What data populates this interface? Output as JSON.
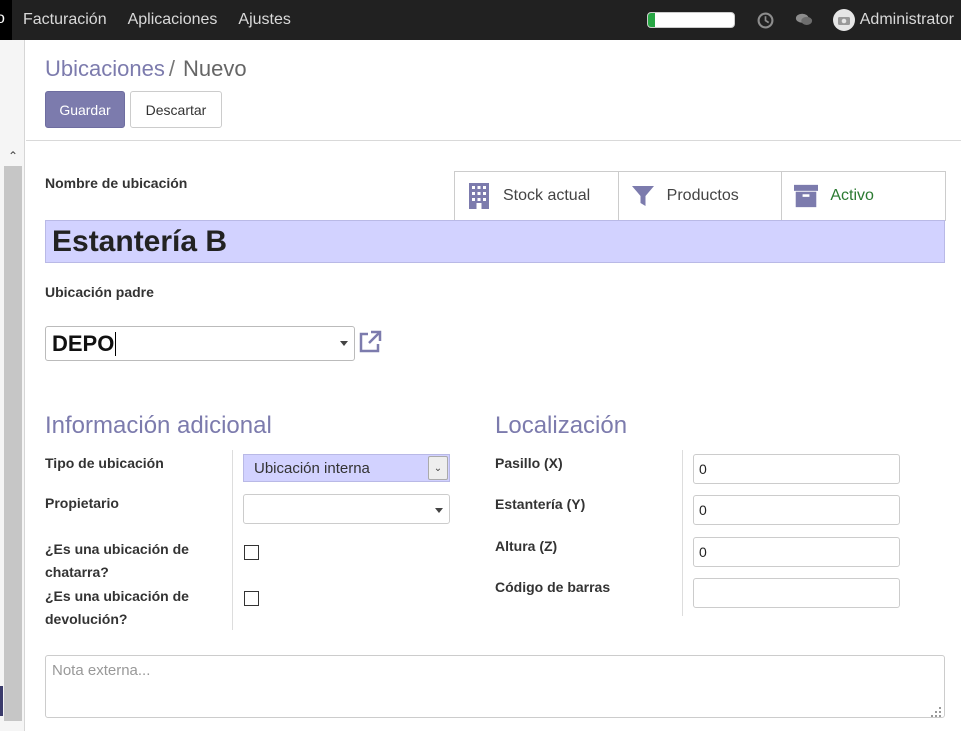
{
  "navbar": {
    "brand_stub": "o",
    "menu": [
      "Facturación",
      "Aplicaciones",
      "Ajustes"
    ],
    "progress": 0.08,
    "progress_color": "#28a745",
    "icons": [
      "clock-icon",
      "chat-icon"
    ],
    "user_name": "Administrator"
  },
  "breadcrumb": {
    "parent": "Ubicaciones",
    "separator": "/",
    "current": "Nuevo"
  },
  "buttons": {
    "save": "Guardar",
    "discard": "Descartar"
  },
  "form": {
    "name_label": "Nombre de ubicación",
    "name_value": "Estantería B",
    "stat_buttons": [
      {
        "icon": "building-icon",
        "label": "Stock actual"
      },
      {
        "icon": "filter-icon",
        "label": "Productos"
      },
      {
        "icon": "archive-icon",
        "label": "Activo"
      }
    ],
    "parent_label": "Ubicación padre",
    "parent_value": "DEPO",
    "additional_info": {
      "title": "Información adicional",
      "type_label": "Tipo de ubicación",
      "type_value": "Ubicación interna",
      "owner_label": "Propietario",
      "owner_value": "",
      "scrap_label_1": "¿Es una ubicación de",
      "scrap_label_2": "chatarra?",
      "scrap_checked": false,
      "return_label_1": "¿Es una ubicación de",
      "return_label_2": "devolución?",
      "return_checked": false
    },
    "localization": {
      "title": "Localización",
      "aisle_label": "Pasillo (X)",
      "aisle_value": "0",
      "shelf_label": "Estantería (Y)",
      "shelf_value": "0",
      "height_label": "Altura (Z)",
      "height_value": "0",
      "barcode_label": "Código de barras",
      "barcode_value": ""
    },
    "note_placeholder": "Nota externa..."
  },
  "colors": {
    "accent": "#7c7bad",
    "required_field_bg": "#d2d2ff",
    "navbar_bg": "#212121",
    "active_green": "#2b7a31"
  }
}
